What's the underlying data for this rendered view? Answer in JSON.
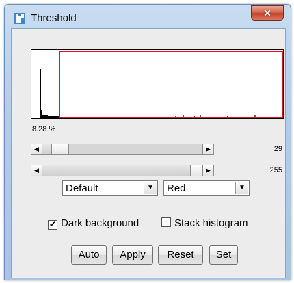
{
  "window": {
    "title": "Threshold",
    "close_glyph": "✕"
  },
  "icons": {
    "app": "imagej-icon",
    "close": "close-icon"
  },
  "histogram": {
    "percent_label": "8.28 %",
    "threshold_color": "#e0141e"
  },
  "sliders": {
    "min": {
      "value": "29",
      "level": 29,
      "max": 255
    },
    "max": {
      "value": "255",
      "level": 255,
      "max": 255
    }
  },
  "method_select": {
    "selected": "Default"
  },
  "display_select": {
    "selected": "Red"
  },
  "options": {
    "dark_background": {
      "label": "Dark background",
      "checked": true
    },
    "stack_histogram": {
      "label": "Stack histogram",
      "checked": false
    }
  },
  "buttons": {
    "auto": "Auto",
    "apply": "Apply",
    "reset": "Reset",
    "set": "Set"
  }
}
